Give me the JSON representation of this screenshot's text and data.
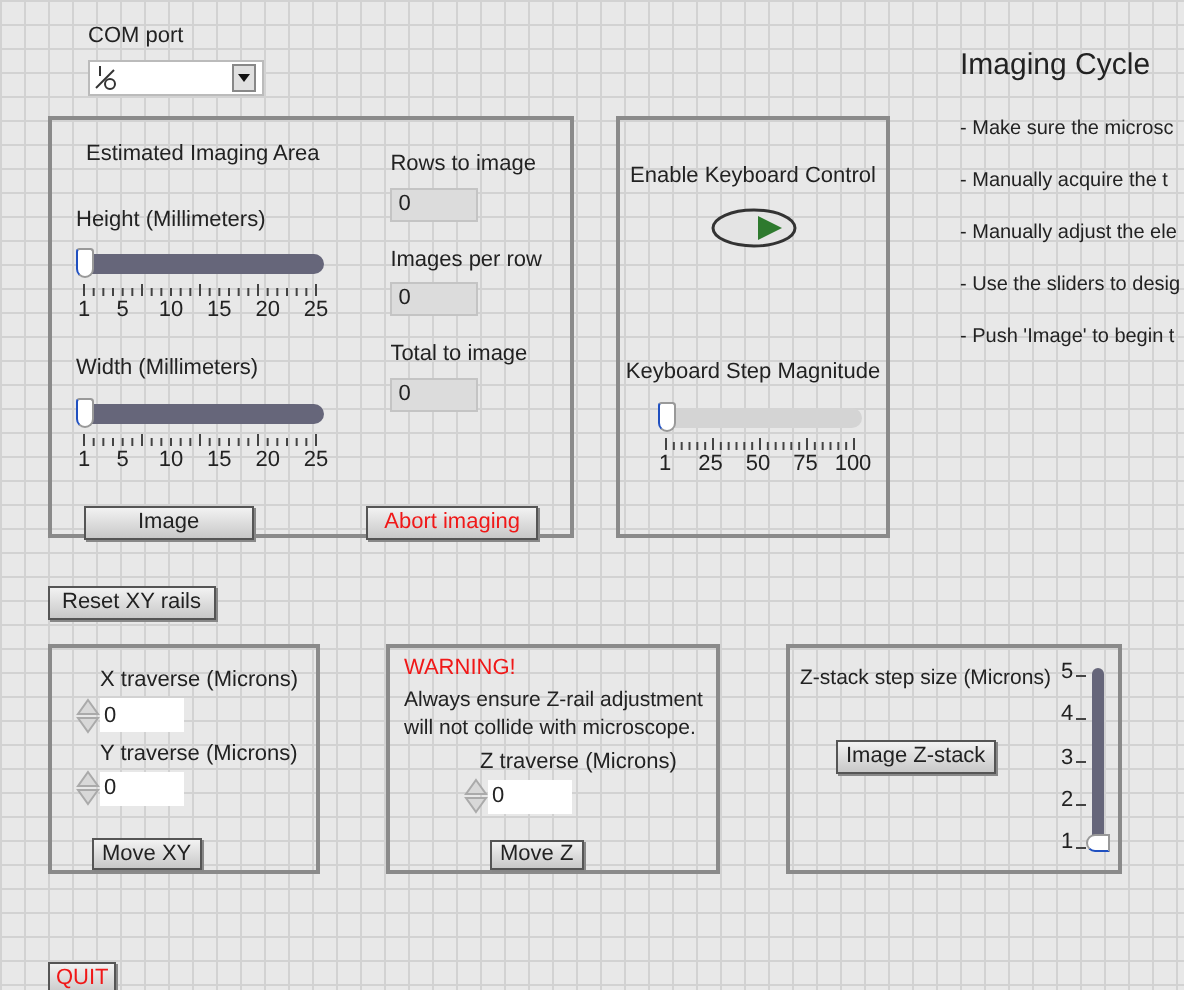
{
  "com_port": {
    "label": "COM port"
  },
  "imaging_area": {
    "title": "Estimated Imaging Area",
    "sliders": [
      {
        "label": "Height (Millimeters)",
        "level": 0,
        "ticks": [
          "1",
          "5",
          "10",
          "15",
          "20",
          "25"
        ]
      },
      {
        "label": "Width (Millimeters)",
        "level": 0,
        "ticks": [
          "1",
          "5",
          "10",
          "15",
          "20",
          "25"
        ]
      }
    ],
    "outputs": [
      {
        "label": "Rows to image",
        "value": "0"
      },
      {
        "label": "Images per row",
        "value": "0"
      },
      {
        "label": "Total to image",
        "value": "0"
      }
    ],
    "buttons": [
      {
        "label": "Image",
        "kind": "normal"
      },
      {
        "label": "Abort imaging",
        "kind": "alert"
      }
    ]
  },
  "keyboard": {
    "toggle_label": "Enable Keyboard Control",
    "on": false,
    "slider": {
      "label": "Keyboard Step Magnitude",
      "level": 0,
      "ticks": [
        "1",
        "25",
        "50",
        "75",
        "100"
      ]
    }
  },
  "imaging_cycle": {
    "title": "Imaging Cycle",
    "steps": [
      "- Make sure the microsc",
      "- Manually acquire the t",
      "- Manually adjust the ele",
      "- Use the sliders to desig",
      "- Push 'Image' to begin t"
    ]
  },
  "reset_button": "Reset XY rails",
  "xy_panel": {
    "fields": [
      {
        "label": "X traverse (Microns)",
        "value": "0"
      },
      {
        "label": "Y traverse (Microns)",
        "value": "0"
      }
    ],
    "button": "Move XY"
  },
  "z_panel": {
    "warning": "WARNING!",
    "message": "Always ensure Z-rail adjustment will not collide with microscope.",
    "field": {
      "label": "Z traverse (Microns)",
      "value": "0"
    },
    "button": "Move Z"
  },
  "zstack": {
    "label": "Z-stack step size (Microns)",
    "button": "Image Z-stack",
    "slider": {
      "level": 0,
      "ticks": [
        "5",
        "4",
        "3",
        "2",
        "1"
      ]
    }
  },
  "quit_button": "QUIT"
}
